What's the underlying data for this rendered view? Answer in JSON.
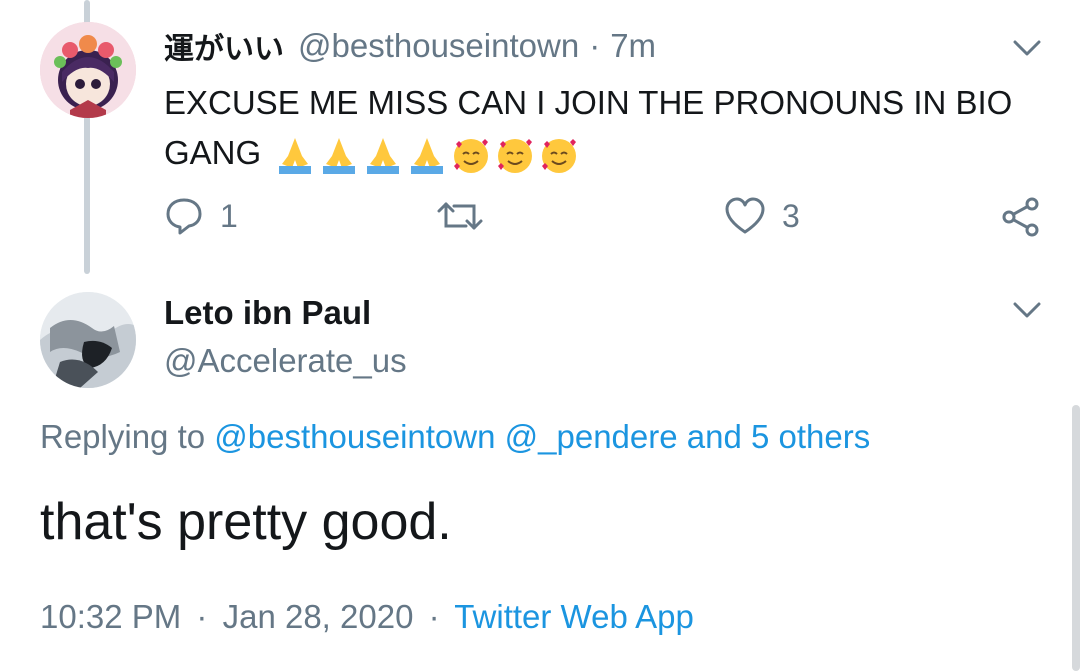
{
  "tweet1": {
    "display_name": "運がいい",
    "handle": "@besthouseintown",
    "separator": "·",
    "time": "7m",
    "text": "EXCUSE ME MISS CAN I JOIN THE PRONOUNS IN BIO GANG",
    "emojis": [
      "folded-hands-emoji",
      "folded-hands-emoji",
      "folded-hands-emoji",
      "folded-hands-emoji",
      "smiling-face-with-hearts-emoji",
      "smiling-face-with-hearts-emoji",
      "smiling-face-with-hearts-emoji"
    ],
    "reply_count": "1",
    "retweet_count": "",
    "like_count": "3"
  },
  "tweet2": {
    "display_name": "Leto ibn Paul",
    "handle": "@Accelerate_us",
    "replying_prefix": "Replying to",
    "replying_handle_1": "@besthouseintown",
    "replying_handle_2": "@_pendere",
    "replying_others": "and 5 others",
    "text": "that's pretty good.",
    "time": "10:32 PM",
    "separator": "·",
    "date": "Jan 28, 2020",
    "source": "Twitter Web App"
  },
  "colors": {
    "link": "#1b95e0",
    "secondary_text": "#657786",
    "primary_text": "#14171a",
    "thread_line": "#c9d1d8"
  }
}
